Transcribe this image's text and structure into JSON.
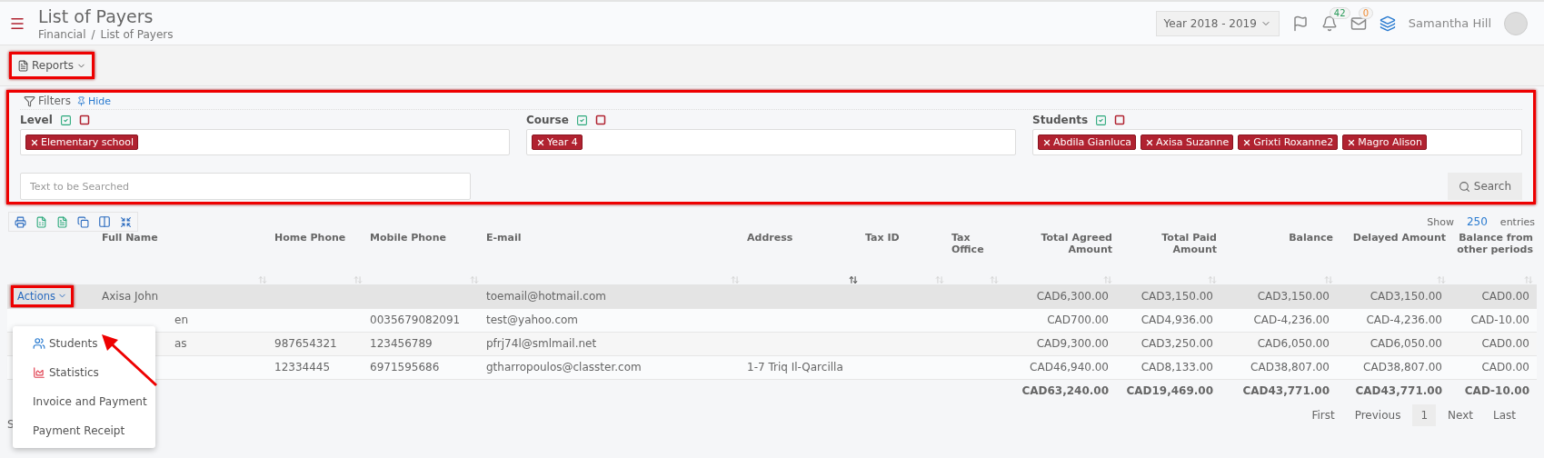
{
  "header": {
    "title": "List of Payers",
    "breadcrumbs": [
      "Financial",
      "List of Payers"
    ],
    "breadcrumb_separator": "/",
    "year": "Year 2018 - 2019",
    "notifications": "42",
    "messages": "0",
    "user": "Samantha Hill"
  },
  "toolbar": {
    "reports": "Reports"
  },
  "filters": {
    "title": "Filters",
    "hide": "Hide",
    "groups": [
      {
        "label": "Level",
        "tags": [
          "Elementary school"
        ]
      },
      {
        "label": "Course",
        "tags": [
          "Year 4"
        ]
      },
      {
        "label": "Students",
        "tags": [
          "Abdila Gianluca",
          "Axisa Suzanne",
          "Grixti Roxanne2",
          "Magro Alison"
        ]
      }
    ],
    "search_placeholder": "Text to be Searched",
    "search_button": "Search"
  },
  "table": {
    "show": "Show",
    "page_size": "250",
    "entries": "entries",
    "columns": [
      {
        "label": "Full Name",
        "kind": "text",
        "sorted": false
      },
      {
        "label": "Home Phone",
        "kind": "text",
        "sorted": false
      },
      {
        "label": "Mobile Phone",
        "kind": "text",
        "sorted": false
      },
      {
        "label": "E-mail",
        "kind": "text",
        "sorted": false
      },
      {
        "label": "Address",
        "kind": "text",
        "sorted": true
      },
      {
        "label": "Tax ID",
        "kind": "text",
        "sorted": false
      },
      {
        "label": "Tax Office",
        "kind": "text",
        "sorted": false
      },
      {
        "label": "Total Agreed Amount",
        "kind": "money",
        "sorted": false
      },
      {
        "label": "Total Paid Amount",
        "kind": "money",
        "sorted": false
      },
      {
        "label": "Balance",
        "kind": "money",
        "sorted": false
      },
      {
        "label": "Delayed Amount",
        "kind": "money",
        "sorted": false
      },
      {
        "label": "Balance from other periods",
        "kind": "money",
        "sorted": false
      }
    ],
    "rows": [
      {
        "selected": true,
        "cells": [
          "Axisa John",
          null,
          null,
          "toemail@hotmail.com",
          null,
          null,
          null,
          "CAD6,300.00",
          "CAD3,150.00",
          "CAD3,150.00",
          "CAD3,150.00",
          "CAD0.00"
        ]
      },
      {
        "selected": false,
        "cells": [
          "en",
          null,
          "0035679082091",
          "test@yahoo.com",
          null,
          null,
          null,
          "CAD700.00",
          "CAD4,936.00",
          "CAD-4,236.00",
          "CAD-4,236.00",
          "CAD-10.00"
        ]
      },
      {
        "selected": false,
        "cells": [
          "as",
          "987654321",
          "123456789",
          "pfrj74l@smlmail.net",
          null,
          null,
          null,
          "CAD9,300.00",
          "CAD3,250.00",
          "CAD6,050.00",
          "CAD6,050.00",
          "CAD0.00"
        ]
      },
      {
        "selected": false,
        "cells": [
          null,
          "12334445",
          "6971595686",
          "gtharropoulos@classter.com",
          "1-7 Triq Il-Qarcilla",
          null,
          null,
          "CAD46,940.00",
          "CAD8,133.00",
          "CAD38,807.00",
          "CAD38,807.00",
          "CAD0.00"
        ]
      }
    ],
    "totals": [
      "CAD63,240.00",
      "CAD19,469.00",
      "CAD43,771.00",
      "CAD43,771.00",
      "CAD-10.00"
    ],
    "footer": "S",
    "pagination": [
      {
        "label": "First",
        "selected": false
      },
      {
        "label": "Previous",
        "selected": false
      },
      {
        "label": "1",
        "selected": true
      },
      {
        "label": "Next",
        "selected": false
      },
      {
        "label": "Last",
        "selected": false
      }
    ]
  },
  "actions_menu": {
    "button": "Actions",
    "open": true,
    "items": [
      {
        "label": "Students",
        "kind": "students"
      },
      {
        "label": "Statistics",
        "kind": "statistics"
      },
      {
        "label": "Invoice and Payment",
        "kind": "plain"
      },
      {
        "label": "Payment Receipt",
        "kind": "plain"
      }
    ]
  }
}
